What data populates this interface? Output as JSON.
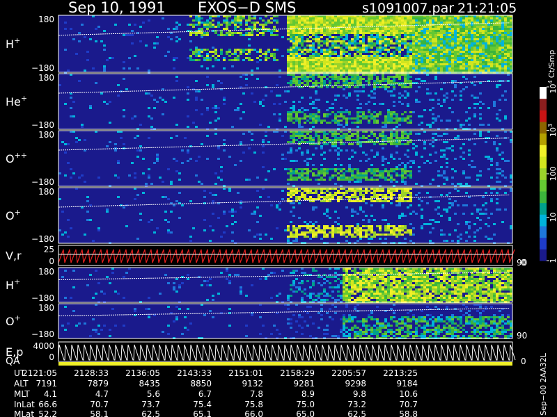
{
  "chart_data": {
    "type": "heatmap",
    "header": {
      "date": "Sep 10, 1991",
      "instrument": "EXOS−D SMS",
      "file": "s1091007.par",
      "time": "21:21:05"
    },
    "colorbar": {
      "unit": "Ct/Smp",
      "scale": "log",
      "range": [
        1,
        10000
      ],
      "ticks": [
        {
          "value": 1,
          "label": "1"
        },
        {
          "value": 10,
          "label": "10"
        },
        {
          "value": 100,
          "label": "100"
        },
        {
          "value": 1000,
          "label": "10",
          "sup": "3"
        },
        {
          "value": 10000,
          "label": "10",
          "sup": "4"
        }
      ],
      "colors": [
        "#1a1a8c",
        "#1e3cc8",
        "#1e78dc",
        "#00b4dc",
        "#00a08c",
        "#3cb43c",
        "#64c832",
        "#9ad22a",
        "#d2e61e",
        "#f0f028",
        "#b4a000",
        "#8c6400",
        "#c81414",
        "#8c1e1e",
        "#ffffff"
      ]
    },
    "panels": [
      {
        "label": "H",
        "sup": "+",
        "ytop": "180",
        "ybot": "−180",
        "kind": "spectrogram"
      },
      {
        "label": "He",
        "sup": "+",
        "ytop": "180",
        "ybot": "−180",
        "kind": "spectrogram"
      },
      {
        "label": "O",
        "sup": "++",
        "ytop": "180",
        "ybot": "−180",
        "kind": "spectrogram"
      },
      {
        "label": "O",
        "sup": "+",
        "ytop": "180",
        "ybot": "−180",
        "kind": "spectrogram"
      },
      {
        "label": "V,r",
        "sup": "",
        "ytop": "25",
        "ybot": "0",
        "right": "90",
        "rightBottom": "0",
        "kind": "line"
      },
      {
        "label": "H",
        "sup": "+",
        "ytop": "180",
        "ybot": "−180",
        "kind": "spectrogram"
      },
      {
        "label": "O",
        "sup": "+",
        "ytop": "180",
        "ybot": "−180",
        "right": "90",
        "kind": "spectrogram"
      },
      {
        "label": "E,p",
        "label2": "QA",
        "sup": "",
        "ytop": "4000",
        "ybot": "0",
        "rightBottom": "0",
        "kind": "steps"
      }
    ],
    "data_onset": "2151:01",
    "ephemeris": {
      "row_labels": [
        "UT",
        "ALT",
        "MLT",
        "InLat",
        "MLat"
      ],
      "columns": [
        [
          "2121:05",
          "7191",
          "4.1",
          "66.6",
          "52.2"
        ],
        [
          "2128:33",
          "7879",
          "4.7",
          "70.7",
          "58.1"
        ],
        [
          "2136:05",
          "8435",
          "5.6",
          "73.7",
          "62.5"
        ],
        [
          "2143:33",
          "8850",
          "6.7",
          "75.4",
          "65.1"
        ],
        [
          "2151:01",
          "9132",
          "7.8",
          "75.8",
          "66.0"
        ],
        [
          "2158:29",
          "9281",
          "8.9",
          "75.0",
          "65.0"
        ],
        [
          "2205:57",
          "9298",
          "9.8",
          "73.2",
          "62.5"
        ],
        [
          "2213:25",
          "9184",
          "10.6",
          "70.7",
          "58.8"
        ]
      ]
    },
    "footer": "Sep−00  2AA32L"
  }
}
